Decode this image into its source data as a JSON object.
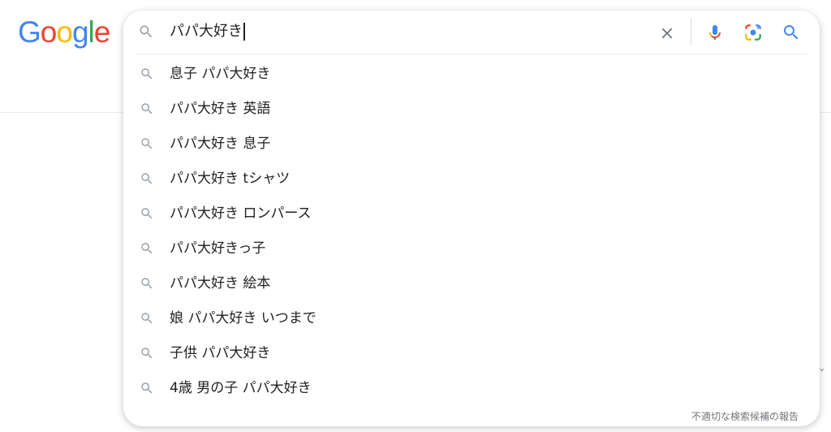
{
  "logo": {
    "letters": [
      {
        "char": "G",
        "color": "#4285F4"
      },
      {
        "char": "o",
        "color": "#EA4335"
      },
      {
        "char": "o",
        "color": "#FBBC05"
      },
      {
        "char": "g",
        "color": "#4285F4"
      },
      {
        "char": "l",
        "color": "#34A853"
      },
      {
        "char": "e",
        "color": "#EA4335"
      }
    ]
  },
  "search": {
    "query": "パパ大好き",
    "icons": {
      "leading": "search-icon",
      "clear": "close-icon",
      "voice": "microphone-icon",
      "lens": "camera-lens-icon",
      "submit": "search-icon"
    }
  },
  "suggestions": [
    "息子 パパ大好き",
    "パパ大好き 英語",
    "パパ大好き 息子",
    "パパ大好き tシャツ",
    "パパ大好き ロンパース",
    "パパ大好きっ子",
    "パパ大好き 絵本",
    "娘 パパ大好き いつまで",
    "子供 パパ大好き",
    "4歳 男の子 パパ大好き"
  ],
  "report_link": "不適切な検索候補の報告",
  "colors": {
    "blue": "#4285F4",
    "red": "#EA4335",
    "yellow": "#FBBC05",
    "green": "#34A853",
    "icon_gray": "#9aa0a6",
    "text": "#202124"
  }
}
